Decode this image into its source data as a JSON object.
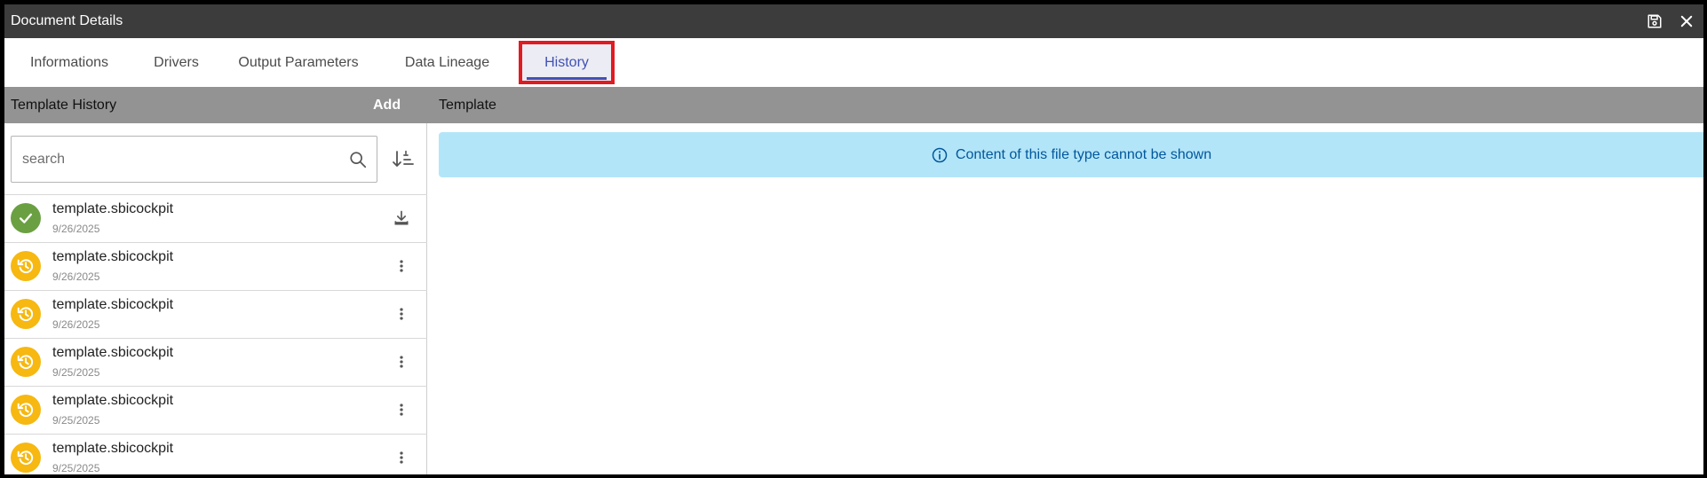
{
  "window": {
    "title": "Document Details",
    "save_icon": "save-icon",
    "close_icon": "close-icon"
  },
  "tabs": [
    {
      "label": "Informations",
      "active": false
    },
    {
      "label": "Drivers",
      "active": false
    },
    {
      "label": "Output Parameters",
      "active": false
    },
    {
      "label": "Data Lineage",
      "active": false
    },
    {
      "label": "History",
      "active": true
    }
  ],
  "colors": {
    "accent": "#3f51b5",
    "highlight_border": "#e11b22",
    "status_ok": "#6aa042",
    "status_history": "#f6b811",
    "banner_bg": "#b3e5f9",
    "banner_text": "#01579b"
  },
  "left_panel": {
    "title": "Template History",
    "add_label": "Add",
    "search_placeholder": "search",
    "search_value": "",
    "items": [
      {
        "name": "template.sbicockpit",
        "date": "9/26/2025",
        "status": "active",
        "status_icon": "check-icon",
        "action_icon": "download-icon"
      },
      {
        "name": "template.sbicockpit",
        "date": "9/26/2025",
        "status": "history",
        "status_icon": "history-icon",
        "action_icon": "more-vert-icon"
      },
      {
        "name": "template.sbicockpit",
        "date": "9/26/2025",
        "status": "history",
        "status_icon": "history-icon",
        "action_icon": "more-vert-icon"
      },
      {
        "name": "template.sbicockpit",
        "date": "9/25/2025",
        "status": "history",
        "status_icon": "history-icon",
        "action_icon": "more-vert-icon"
      },
      {
        "name": "template.sbicockpit",
        "date": "9/25/2025",
        "status": "history",
        "status_icon": "history-icon",
        "action_icon": "more-vert-icon"
      },
      {
        "name": "template.sbicockpit",
        "date": "9/25/2025",
        "status": "history",
        "status_icon": "history-icon",
        "action_icon": "more-vert-icon"
      }
    ]
  },
  "right_panel": {
    "title": "Template",
    "message": "Content of this file type cannot be shown"
  }
}
